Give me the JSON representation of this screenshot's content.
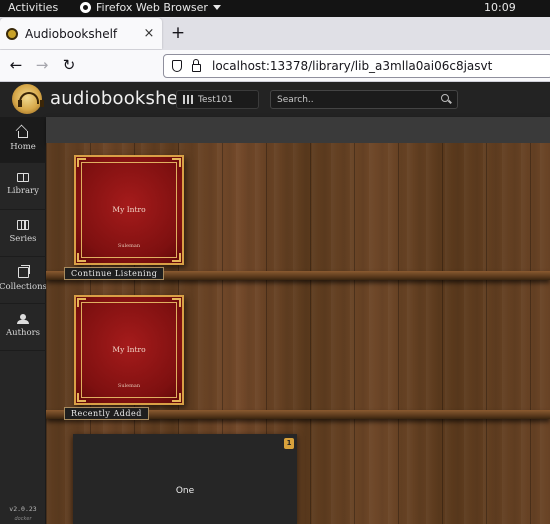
{
  "system": {
    "activities": "Activities",
    "app_menu": "Firefox Web Browser",
    "clock": "10:09"
  },
  "browser": {
    "tab_title": "Audiobookshelf",
    "tab_close": "×",
    "new_tab": "+",
    "url": "localhost:13378/library/lib_a3mlla0ai06c8jasvt",
    "nav": {
      "back": "←",
      "forward": "→",
      "reload": "↻"
    }
  },
  "header": {
    "title": "audiobookshelf",
    "library": "Test101",
    "search_placeholder": "Search.."
  },
  "sidebar": {
    "items": [
      {
        "label": "Home",
        "icon": "home-icon"
      },
      {
        "label": "Library",
        "icon": "book-icon"
      },
      {
        "label": "Series",
        "icon": "columns-icon"
      },
      {
        "label": "Collections",
        "icon": "collections-icon"
      },
      {
        "label": "Authors",
        "icon": "users-icon"
      }
    ],
    "version": "v2.0.23",
    "build": "docker"
  },
  "shelves": [
    {
      "label": "Continue Listening",
      "book": {
        "title": "My Intro",
        "author": "Suleman"
      }
    },
    {
      "label": "Recently Added",
      "book": {
        "title": "My Intro",
        "author": "Suleman"
      }
    }
  ],
  "series": {
    "title": "One",
    "count": "1"
  },
  "colors": {
    "accent": "#d8a23c",
    "cover_red": "#7e1010",
    "cover_gold": "#d9a046",
    "header_bg": "#232323"
  }
}
